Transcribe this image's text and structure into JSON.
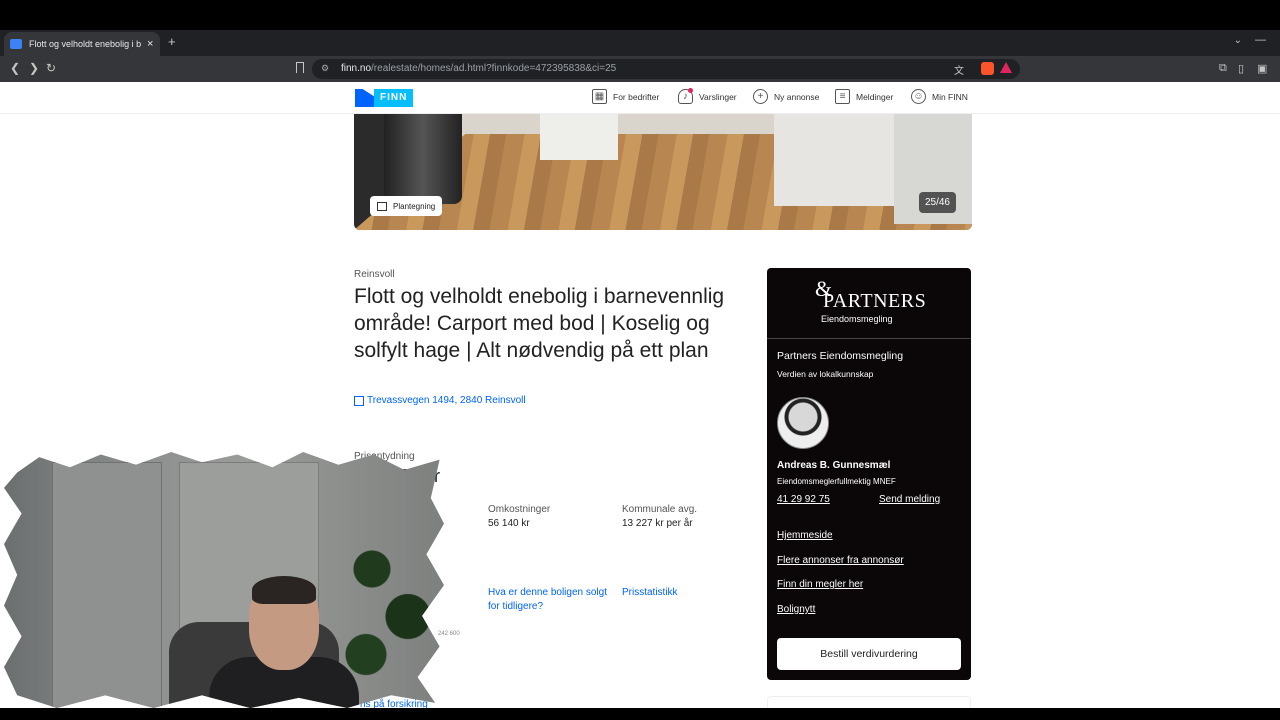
{
  "browser": {
    "tab_title": "Flott og velholdt enebolig i barn",
    "tab_close": "×",
    "new_tab": "+",
    "url_host": "finn.no",
    "url_path": "/realestate/homes/ad.html?finnkode=472395838&ci=25"
  },
  "header": {
    "logo_text": "FINN",
    "nav": {
      "business": "For bedrifter",
      "alerts": "Varslinger",
      "new_ad": "Ny annonse",
      "messages": "Meldinger",
      "my_finn": "Min FINN"
    }
  },
  "gallery": {
    "floorplan_label": "Plantegning",
    "counter": "25/46"
  },
  "listing": {
    "locality": "Reinsvoll",
    "title": "Flott og velholdt enebolig i barnevennlig område! Carport med bod | Koselig og solfylt hage | Alt nødvendig på ett plan",
    "address": "Trevassvegen 1494, 2840 Reinsvoll",
    "price_label": "Prisantydning",
    "price_partial": "00 kr",
    "costs_label": "Omkostninger",
    "costs_value": "56 140 kr",
    "municipal_label": "Kommunale avg.",
    "municipal_value": "13 227 kr per år",
    "sold_before_link": "Hva er denne boligen solgt for tidligere?",
    "price_stats_link": "Prisstatistikk",
    "insurance_link_partial": "ris på forsikring",
    "chart_small_a": "242 600"
  },
  "agent": {
    "brand_amp": "&",
    "brand_name": "PARTNERS",
    "brand_sub": "Eiendomsmegling",
    "company": "Partners Eiendomsmegling",
    "tagline": "Verdien av lokalkunnskap",
    "name": "Andreas B. Gunnesmæl",
    "role": "Eiendomsmeglerfullmektig MNEF",
    "phone": "41 29 92 75",
    "send_message": "Send melding",
    "links": [
      "Hjemmeside",
      "Flere annonser fra annonsør",
      "Finn din megler her",
      "Bolignytt"
    ],
    "cta": "Bestill verdivurdering"
  }
}
